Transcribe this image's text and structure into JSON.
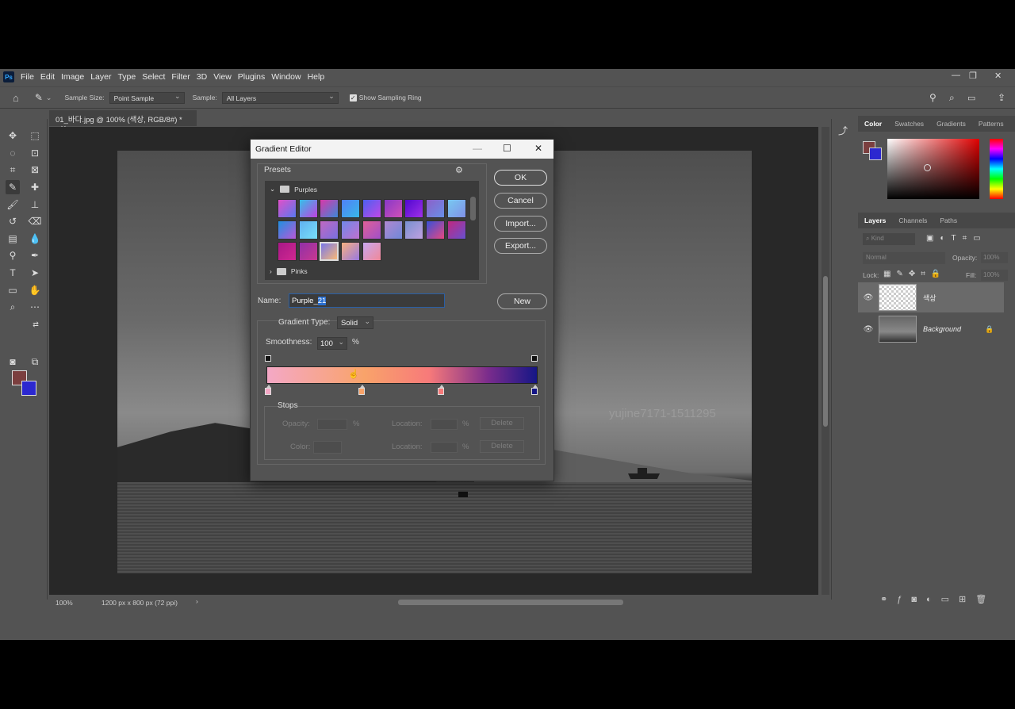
{
  "menubar": {
    "logo": "Ps",
    "items": [
      "File",
      "Edit",
      "Image",
      "Layer",
      "Type",
      "Select",
      "Filter",
      "3D",
      "View",
      "Plugins",
      "Window",
      "Help"
    ]
  },
  "options": {
    "sample_size_label": "Sample Size:",
    "sample_size_value": "Point Sample",
    "sample_label": "Sample:",
    "sample_value": "All Layers",
    "show_ring_label": "Show Sampling Ring"
  },
  "document": {
    "tab_title": "01_바다.jpg @ 100% (색상, RGB/8#) *",
    "watermark": "yujine7171-1511295",
    "zoom": "100%",
    "doc_info": "1200 px x 800 px (72 ppi)"
  },
  "color_panel": {
    "tabs": [
      "Color",
      "Swatches",
      "Gradients",
      "Patterns"
    ],
    "foreground": "#7b3f3f",
    "background": "#2c28d0"
  },
  "layers_panel": {
    "tabs": [
      "Layers",
      "Channels",
      "Paths"
    ],
    "kind_placeholder": "Kind",
    "blend_mode": "Normal",
    "opacity_label": "Opacity:",
    "opacity_value": "100%",
    "lock_label": "Lock:",
    "fill_label": "Fill:",
    "fill_value": "100%",
    "layers": [
      {
        "name": "색상",
        "selected": true
      },
      {
        "name": "Background",
        "locked": true
      }
    ]
  },
  "gradient_editor": {
    "title": "Gradient Editor",
    "presets_label": "Presets",
    "folders": [
      "Purples",
      "Pinks"
    ],
    "swatches": [
      [
        "#e050c8",
        "#5878f0"
      ],
      [
        "#34c0e8",
        "#c040e0"
      ],
      [
        "#d838a8",
        "#3c88d8"
      ],
      [
        "#5080f8",
        "#38b8e8"
      ],
      [
        "#4c60f0",
        "#c048e8"
      ],
      [
        "#8838c8",
        "#d050b8"
      ],
      [
        "#5008d0",
        "#a030e8"
      ],
      [
        "#8c60c8",
        "#6890e8"
      ],
      [
        "#78c8f0",
        "#8090e8"
      ],
      [
        "#2090e0",
        "#b858d8"
      ],
      [
        "#60b0f0",
        "#78e0f8"
      ],
      [
        "#c068c0",
        "#7870e0"
      ],
      [
        "#7088e8",
        "#c070d0"
      ],
      [
        "#e06098",
        "#a050c8"
      ],
      [
        "#b088d0",
        "#7088d8"
      ],
      [
        "#7890d0",
        "#c0a0e0"
      ],
      [
        "#3850d8",
        "#e84880"
      ],
      [
        "#c02880",
        "#6850d0"
      ],
      [
        "#a81888",
        "#d02890"
      ],
      [
        "#9030a8",
        "#c83890"
      ],
      [
        "#7878e8",
        "#f8b878"
      ],
      [
        "#f8b080",
        "#9878e0"
      ],
      [
        "#c8a8f0",
        "#f08898"
      ]
    ],
    "buttons": {
      "ok": "OK",
      "cancel": "Cancel",
      "import": "Import...",
      "export": "Export...",
      "new": "New"
    },
    "name_label": "Name:",
    "name_value_prefix": "Purple_",
    "name_value_selected": "21",
    "gradient_type_label": "Gradient Type:",
    "gradient_type_value": "Solid",
    "smoothness_label": "Smoothness:",
    "smoothness_value": "100",
    "smoothness_unit": "%",
    "color_stops": [
      "#f4a8c6",
      "#f9a36a",
      "#f77a7a",
      "#151686"
    ],
    "stops_section": {
      "label": "Stops",
      "opacity_label": "Opacity:",
      "location_label": "Location:",
      "color_label": "Color:",
      "pct": "%",
      "delete_label": "Delete"
    }
  }
}
